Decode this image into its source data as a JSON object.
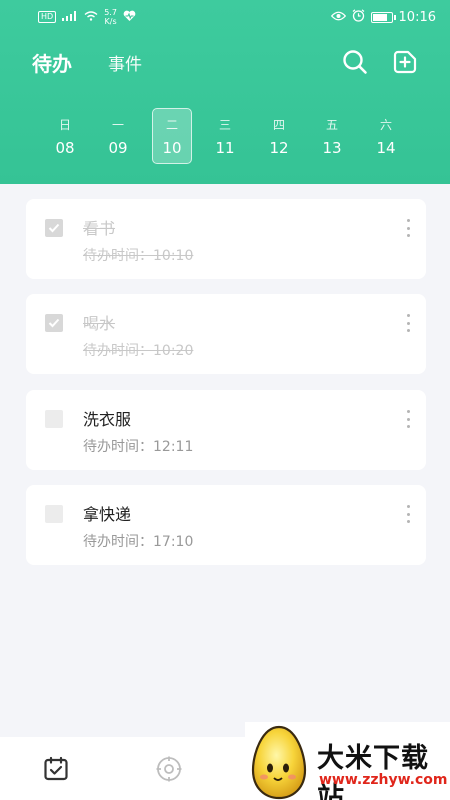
{
  "statusbar": {
    "network_badge": "HD",
    "signal_label": "⁴ᴳ",
    "speed_value": "5.7",
    "speed_unit": "K/s",
    "time": "10:16"
  },
  "nav": {
    "tab_todo": "待办",
    "tab_event": "事件"
  },
  "week": {
    "days": [
      {
        "weekday": "日",
        "date": "08",
        "selected": false
      },
      {
        "weekday": "一",
        "date": "09",
        "selected": false
      },
      {
        "weekday": "二",
        "date": "10",
        "selected": true
      },
      {
        "weekday": "三",
        "date": "11",
        "selected": false
      },
      {
        "weekday": "四",
        "date": "12",
        "selected": false
      },
      {
        "weekday": "五",
        "date": "13",
        "selected": false
      },
      {
        "weekday": "六",
        "date": "14",
        "selected": false
      }
    ]
  },
  "todos": [
    {
      "title": "看书",
      "time": "待办时间：10:10",
      "done": true
    },
    {
      "title": "喝水",
      "time": "待办时间：10:20",
      "done": true
    },
    {
      "title": "洗衣服",
      "time": "待办时间：12:11",
      "done": false
    },
    {
      "title": "拿快递",
      "time": "待办时间：17:10",
      "done": false
    }
  ],
  "icons": {
    "search": "search-icon",
    "add": "add-square-icon",
    "more": "more-vertical-icon",
    "bottom_todo": "calendar-check-icon",
    "bottom_event": "target-icon"
  },
  "colors": {
    "accent": "#35c395",
    "background": "#f4f5f9",
    "done_text": "#c8c8c8",
    "watermark_red": "#e0261b"
  },
  "watermark": {
    "title": "大米下载站",
    "url": "www.zzhyw.com"
  }
}
